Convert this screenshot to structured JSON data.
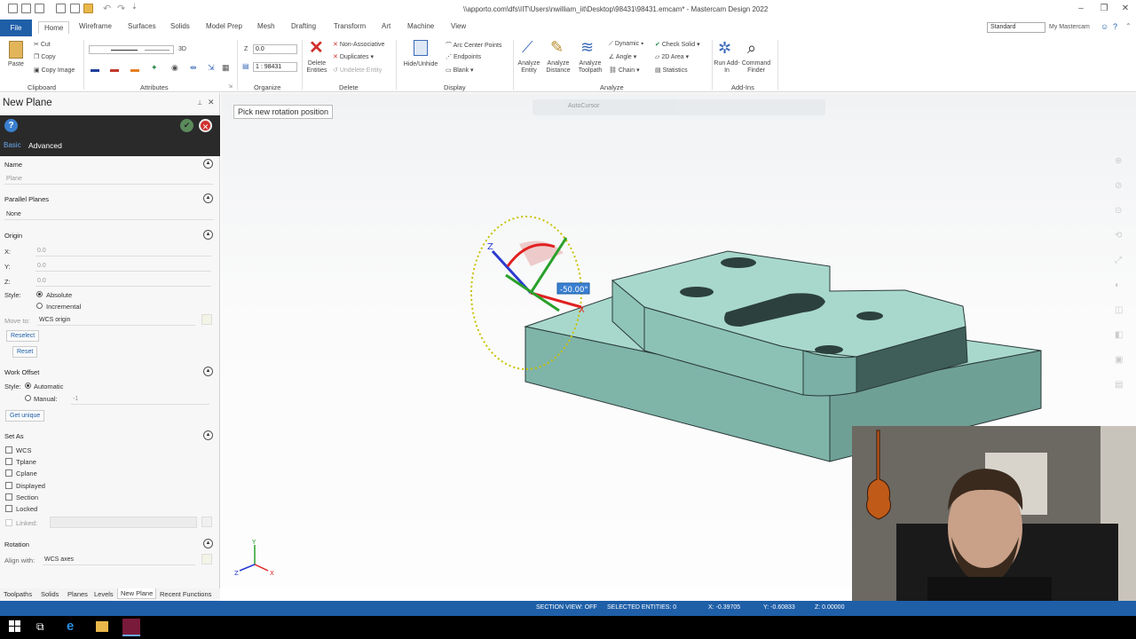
{
  "window": {
    "title": "\\\\apporto.com\\dfs\\IIT\\Users\\nwilliam_iit\\Desktop\\98431\\98431.emcam* - Mastercam Design 2022"
  },
  "ribbon_tabs": [
    "File",
    "Home",
    "Wireframe",
    "Surfaces",
    "Solids",
    "Model Prep",
    "Mesh",
    "Drafting",
    "Transform",
    "Art",
    "Machine",
    "View"
  ],
  "right_header": {
    "select_value": "Standard",
    "my_mastercam": "My Mastercam"
  },
  "ribbon": {
    "clipboard": {
      "paste": "Paste",
      "cut": "Cut",
      "copy": "Copy",
      "copy_image": "Copy Image",
      "label": "Clipboard"
    },
    "attributes": {
      "label": "Attributes",
      "mode_3d": "3D"
    },
    "organize": {
      "z_label": "Z",
      "z_value": "0.0",
      "level_value": "1 : 98431",
      "label": "Organize"
    },
    "delete": {
      "delete_entities": "Delete Entities",
      "non_assoc": "Non-Associative",
      "duplicates": "Duplicates",
      "undelete": "Undelete Entity",
      "label": "Delete"
    },
    "display": {
      "hide_unhide": "Hide/Unhide",
      "arc_centers": "Arc Center Points",
      "endpoints": "Endpoints",
      "blank": "Blank",
      "label": "Display"
    },
    "analyze": {
      "analyze_entity": "Analyze Entity",
      "analyze_distance": "Analyze Distance",
      "analyze_toolpath": "Analyze Toolpath",
      "dynamic": "Dynamic",
      "angle": "Angle",
      "chain": "Chain",
      "check_solid": "Check Solid",
      "area_2d": "2D Area",
      "statistics": "Statistics",
      "label": "Analyze"
    },
    "addins": {
      "run_addin": "Run Add-In",
      "command_finder": "Command Finder",
      "label": "Add-Ins"
    }
  },
  "panel": {
    "title": "New Plane",
    "tabs": [
      "Basic",
      "Advanced"
    ],
    "name": {
      "label": "Name",
      "placeholder": "Plane"
    },
    "parallel": {
      "label": "Parallel Planes",
      "value": "None"
    },
    "origin": {
      "label": "Origin",
      "x_label": "X:",
      "x_value": "0.0",
      "y_label": "Y:",
      "y_value": "0.0",
      "z_label": "Z:",
      "z_value": "0.0",
      "style_label": "Style:",
      "absolute": "Absolute",
      "incremental": "Incremental",
      "move_to_label": "Move to:",
      "move_to_value": "WCS origin",
      "reselect": "Reselect",
      "reset": "Reset"
    },
    "work_offset": {
      "label": "Work Offset",
      "style_label": "Style:",
      "automatic": "Automatic",
      "manual": "Manual:",
      "manual_value": "-1",
      "get_unique": "Get unique"
    },
    "set_as": {
      "label": "Set As",
      "items": [
        "WCS",
        "Tplane",
        "Cplane",
        "Displayed",
        "Section",
        "Locked"
      ],
      "linked_label": "Linked:"
    },
    "rotation": {
      "label": "Rotation",
      "align_label": "Align with:",
      "align_value": "WCS axes"
    }
  },
  "viewport": {
    "hint": "Pick new rotation position",
    "autocursor": "AutoCursor",
    "angle_readout": "-50.00°",
    "gnomon_axes": {
      "x": "X",
      "y": "Y",
      "z": "Z"
    },
    "model_color": "#a8d8cc",
    "model_edge_color": "#2a3a38"
  },
  "bottom_tabs": [
    "Toolpaths",
    "Solids",
    "Planes",
    "Levels",
    "New Plane",
    "Recent Functions"
  ],
  "status": {
    "section_view": "SECTION VIEW: OFF",
    "selected": "SELECTED ENTITIES: 0",
    "x": "X:  -0.39705",
    "y": "Y:  -0.60833",
    "z": "Z:  0.00000"
  }
}
